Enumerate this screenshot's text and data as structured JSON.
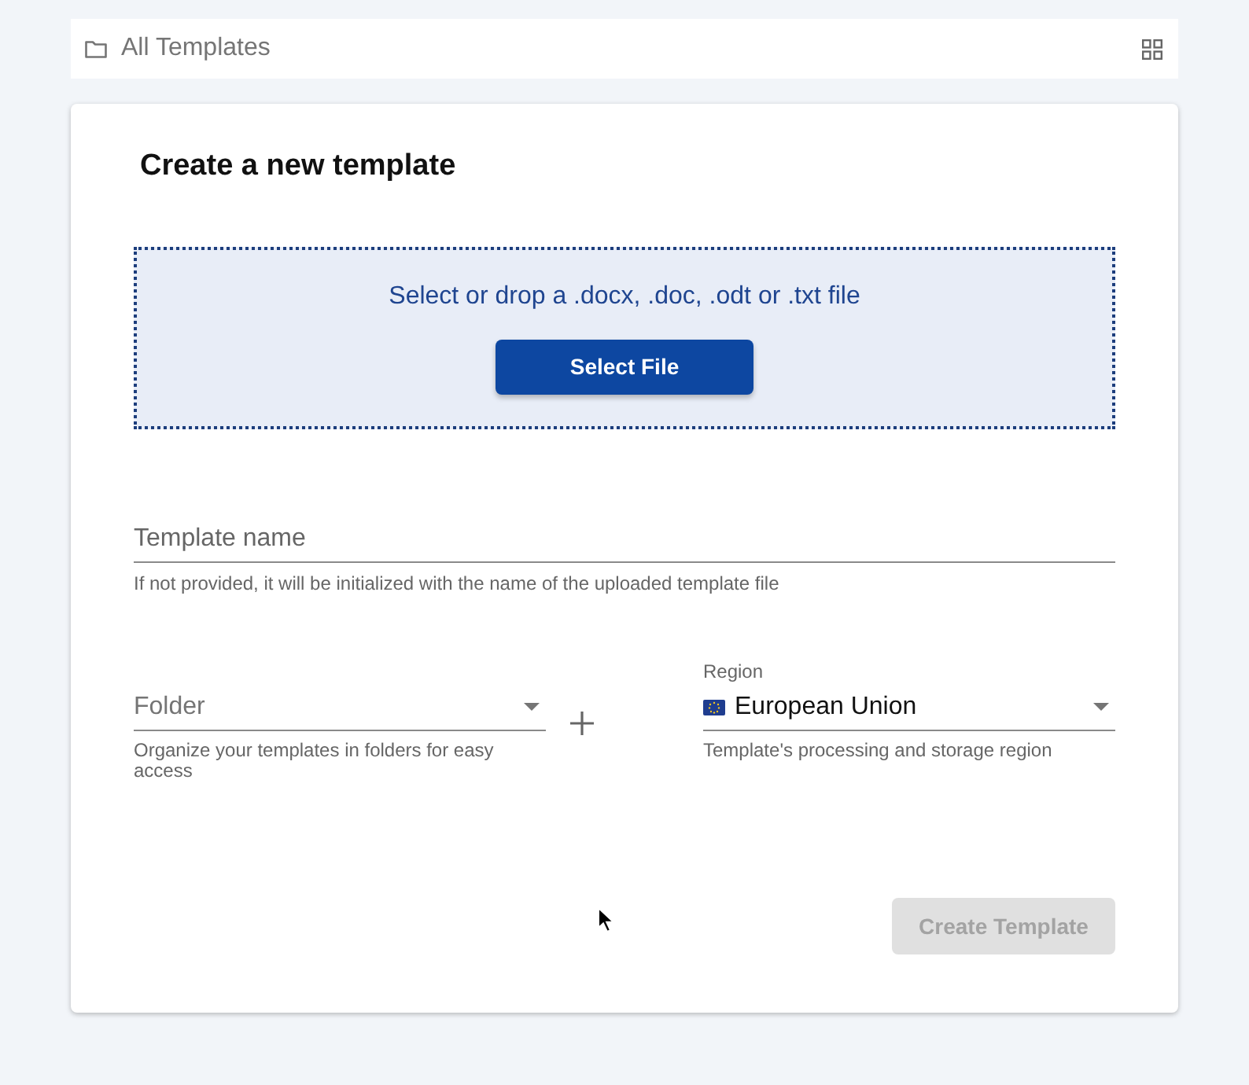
{
  "breadcrumb": {
    "title": "All Templates"
  },
  "card": {
    "title": "Create a new template",
    "dropzone": {
      "prompt": "Select or drop a .docx, .doc, .odt or .txt file",
      "button": "Select File"
    },
    "template_name": {
      "placeholder": "Template name",
      "helper": "If not provided, it will be initialized with the name of the uploaded template file"
    },
    "folder": {
      "placeholder": "Folder",
      "helper": "Organize your templates in folders for easy access"
    },
    "region": {
      "label": "Region",
      "value": "European Union",
      "helper": "Template's processing and storage region"
    },
    "create_button": {
      "label": "Create Template",
      "disabled": true
    }
  }
}
